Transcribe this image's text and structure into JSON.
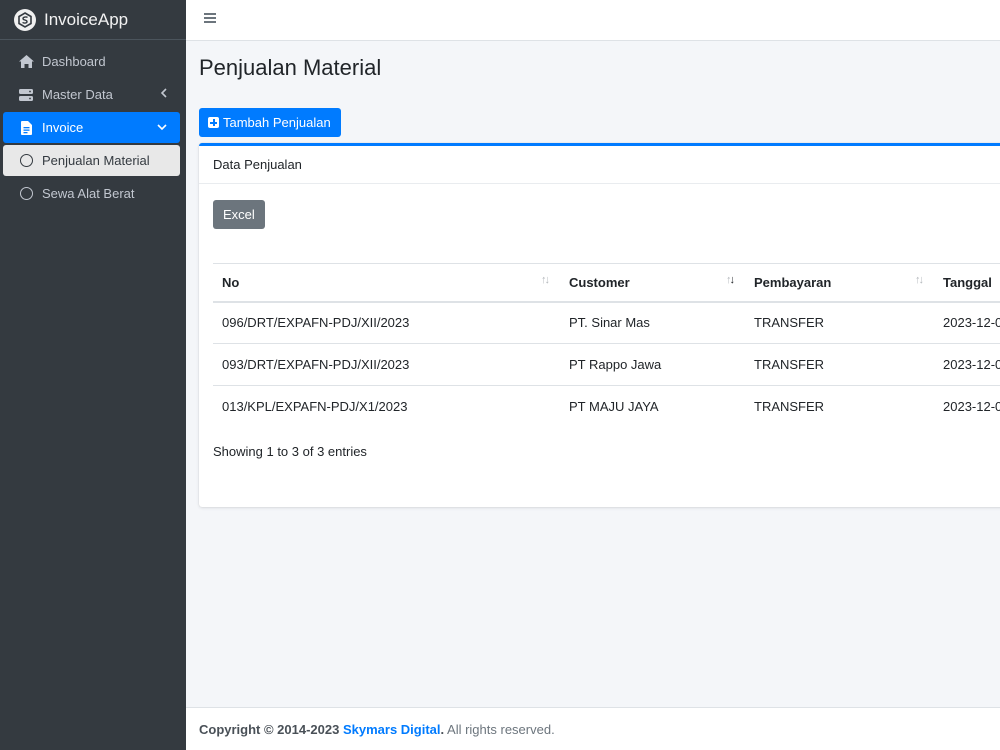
{
  "app": {
    "brand": "InvoiceApp"
  },
  "sidebar": {
    "items": [
      {
        "label": "Dashboard",
        "icon": "home-icon"
      },
      {
        "label": "Master Data",
        "icon": "server-icon"
      },
      {
        "label": "Invoice",
        "icon": "file-invoice-icon"
      },
      {
        "label": "Penjualan Material",
        "icon": "circle-icon"
      },
      {
        "label": "Sewa Alat Berat",
        "icon": "circle-icon"
      }
    ]
  },
  "page": {
    "title": "Penjualan Material",
    "add_button": "Tambah Penjualan"
  },
  "card": {
    "title": "Data Penjualan",
    "excel_button": "Excel",
    "columns": [
      "No",
      "Customer",
      "Pembayaran",
      "Tanggal"
    ],
    "rows": [
      {
        "no": "096/DRT/EXPAFN-PDJ/XII/2023",
        "customer": "PT. Sinar Mas",
        "pembayaran": "TRANSFER",
        "tanggal": "2023-12-0"
      },
      {
        "no": "093/DRT/EXPAFN-PDJ/XII/2023",
        "customer": "PT Rappo Jawa",
        "pembayaran": "TRANSFER",
        "tanggal": "2023-12-0"
      },
      {
        "no": "013/KPL/EXPAFN-PDJ/X1/2023",
        "customer": "PT MAJU JAYA",
        "pembayaran": "TRANSFER",
        "tanggal": "2023-12-0"
      }
    ],
    "info": "Showing 1 to 3 of 3 entries"
  },
  "footer": {
    "prefix": "Copyright © 2014-2023 ",
    "company": "Skymars Digital",
    "suffix": ". All rights reserved."
  },
  "colors": {
    "primary": "#007bff",
    "sidebar_bg": "#343a40",
    "secondary": "#6c757d"
  }
}
